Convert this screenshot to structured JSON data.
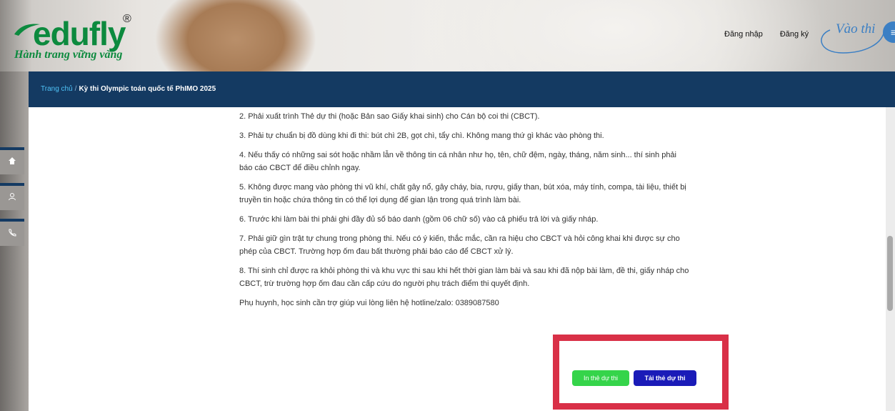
{
  "brand": {
    "logo_text": "edufly",
    "registered": "®",
    "tagline": "Hành trang vững vàng"
  },
  "nav": {
    "login": "Đăng nhập",
    "register": "Đăng ký",
    "enter_exam": "Vào thi",
    "menu_icon": "≡"
  },
  "breadcrumb": {
    "home": "Trang chủ",
    "separator": "/",
    "current": "Kỳ thi Olympic toán quốc tế PhIMO 2025"
  },
  "side_icons": [
    "home-icon",
    "user-icon",
    "phone-icon"
  ],
  "rules": [
    "2. Phải xuất trình Thẻ dự thi (hoặc Bản sao Giấy khai sinh) cho Cán bộ coi thi (CBCT).",
    "3. Phải tự chuẩn bị đồ dùng khi đi thi: bút chì 2B, gọt chì, tẩy chì. Không mang thứ gì khác vào phòng thi.",
    "4. Nếu thấy có những sai sót hoặc nhầm lẫn về thông tin cá nhân như họ, tên, chữ đệm, ngày, tháng, năm sinh... thí sinh phải báo cáo CBCT để điều chỉnh ngay.",
    "5. Không được mang vào phòng thi vũ khí, chất gây nổ, gây cháy, bia, rượu, giấy than, bút xóa, máy tính, compa, tài liệu, thiết bị truyền tin hoặc chứa thông tin có thể lợi dụng để gian lận trong quá trình làm bài.",
    "6. Trước khi làm bài thi phải ghi đầy đủ số báo danh (gồm 06 chữ số) vào cả phiếu trả lời và giấy nháp.",
    "7. Phải giữ gìn trật tự chung trong phòng thi. Nếu có ý kiến, thắc mắc, cần ra hiệu cho CBCT và hỏi công khai khi được sự cho phép của CBCT. Trường hợp ốm đau bất thường phải báo cáo để CBCT xử lý.",
    "8. Thí sinh chỉ được ra khỏi phòng thi và khu vực thi sau khi hết thời gian làm bài và sau khi đã nộp bài làm, đề thi, giấy nháp cho CBCT, trừ trường hợp ốm đau cần cấp cứu do người phụ trách điểm thi quyết định.",
    "Phụ huynh, học sinh cần trợ giúp vui lòng liên hệ hotline/zalo: 0389087580"
  ],
  "actions": {
    "print_card": "In thẻ dự thi",
    "download_card": "Tải thẻ dự thi"
  },
  "colors": {
    "brand_green": "#0c8a3e",
    "navbar": "#143a62",
    "print_button": "#35d44a",
    "download_button": "#1a1bb8",
    "highlight": "#d93047"
  }
}
